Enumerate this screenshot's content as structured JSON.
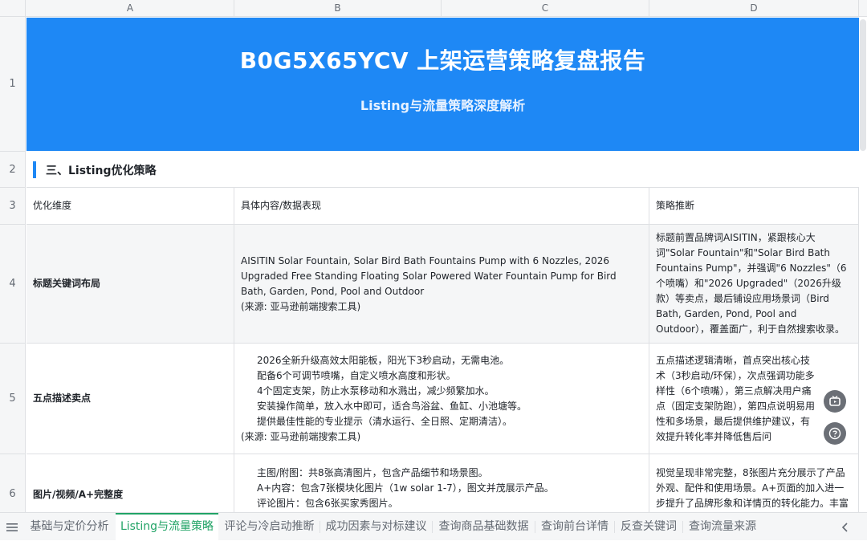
{
  "columns": [
    "A",
    "B",
    "C",
    "D"
  ],
  "rows": [
    "1",
    "2",
    "3",
    "4",
    "5",
    "6"
  ],
  "banner": {
    "title": "B0G5X65YCV 上架运营策略复盘报告",
    "subtitle": "Listing与流量策略深度解析"
  },
  "section": {
    "title": "三、Listing优化策略"
  },
  "table": {
    "headers": [
      "优化维度",
      "具体内容/数据表现",
      "策略推断"
    ],
    "rows": [
      {
        "dimension": "标题关键词布局",
        "content": [
          "AISITIN Solar Fountain, Solar Bird Bath Fountains Pump with 6 Nozzles, 2026 Upgraded Free Standing Floating Solar Powered Water Fountain Pump for Bird Bath, Garden, Pond, Pool and Outdoor",
          "(来源: 亚马逊前端搜索工具)"
        ],
        "strategy": "标题前置品牌词AISITIN，紧跟核心大词\"Solar Fountain\"和\"Solar Bird Bath Fountains Pump\"，并强调\"6 Nozzles\"（6个喷嘴）和\"2026 Upgraded\"（2026升级款）等卖点，最后铺设应用场景词（Bird Bath, Garden, Pond, Pool and Outdoor），覆盖面广，利于自然搜索收录。"
      },
      {
        "dimension": "五点描述卖点",
        "content": [
          "2026全新升级高效太阳能板，阳光下3秒启动，无需电池。",
          "配备6个可调节喷嘴，自定义喷水高度和形状。",
          "4个固定支架，防止水泵移动和水溅出，减少频繁加水。",
          "安装操作简单，放入水中即可，适合鸟浴盆、鱼缸、小池塘等。",
          "提供最佳性能的专业提示（清水运行、全日照、定期清洁）。",
          "(来源: 亚马逊前端搜索工具)"
        ],
        "strategy": "五点描述逻辑清晰，首点突出核心技术（3秒启动/环保），次点强调功能多样性（6个喷嘴），第三点解决用户痛点（固定支架防跑），第四点说明易用性和多场景，最后提供维护建议，有效提升转化率并降低售后问"
      },
      {
        "dimension": "图片/视频/A+完整度",
        "content": [
          "主图/附图：共8张高清图片，包含产品细节和场景图。",
          "A+内容：包含7张模块化图片（1w solar 1-7），图文并茂展示产品。",
          "评论图片：包含6张买家秀图片。"
        ],
        "strategy": "视觉呈现非常完整，8张图片充分展示了产品外观、配件和使用场景。A+页面的加入进一步提升了品牌形象和详情页的转化能力。丰富的买"
      }
    ]
  },
  "tabs": [
    {
      "label": "基础与定价分析",
      "active": false
    },
    {
      "label": "Listing与流量策略",
      "active": true
    },
    {
      "label": "评论与冷启动推断",
      "active": false
    },
    {
      "label": "成功因素与对标建议",
      "active": false
    },
    {
      "label": "查询商品基础数据",
      "active": false
    },
    {
      "label": "查询前台详情",
      "active": false
    },
    {
      "label": "反查关键词",
      "active": false
    },
    {
      "label": "查询流量来源",
      "active": false
    }
  ],
  "icons": {
    "menu": "menu-icon",
    "prev": "chevron-left-icon",
    "fab1": "tv-icon",
    "fab2": "help-icon"
  },
  "colors": {
    "banner": "#1e88f5",
    "active_tab": "#21a366"
  }
}
